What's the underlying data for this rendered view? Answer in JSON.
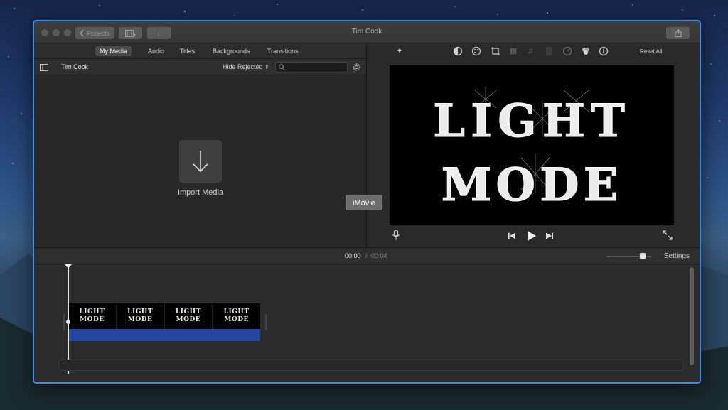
{
  "window": {
    "title": "Tim Cook"
  },
  "toolbar": {
    "projects_label": "Projects",
    "reset_all": "Reset All"
  },
  "browser": {
    "tabs": [
      {
        "label": "My Media",
        "active": true
      },
      {
        "label": "Audio",
        "active": false
      },
      {
        "label": "Titles",
        "active": false
      },
      {
        "label": "Backgrounds",
        "active": false
      },
      {
        "label": "Transitions",
        "active": false
      }
    ],
    "library_name": "Tim Cook",
    "filter": "Hide Rejected",
    "search_placeholder": "",
    "import_label": "Import Media"
  },
  "viewer": {
    "title_line1": "LIGHT",
    "title_line2": "MODE",
    "tooltip": "iMovie"
  },
  "timecode": {
    "current": "00:00",
    "separator": "/",
    "total": "00:04"
  },
  "timeline": {
    "settings_label": "Settings",
    "clip_frames": [
      {
        "line1": "LIGHT",
        "line2": "MODE"
      },
      {
        "line1": "LIGHT",
        "line2": "MODE"
      },
      {
        "line1": "LIGHT",
        "line2": "MODE"
      },
      {
        "line1": "LIGHT",
        "line2": "MODE"
      }
    ]
  },
  "colors": {
    "window_border": "#3f8de8",
    "audio_track": "#2346a0",
    "panel_bg": "#282828"
  }
}
